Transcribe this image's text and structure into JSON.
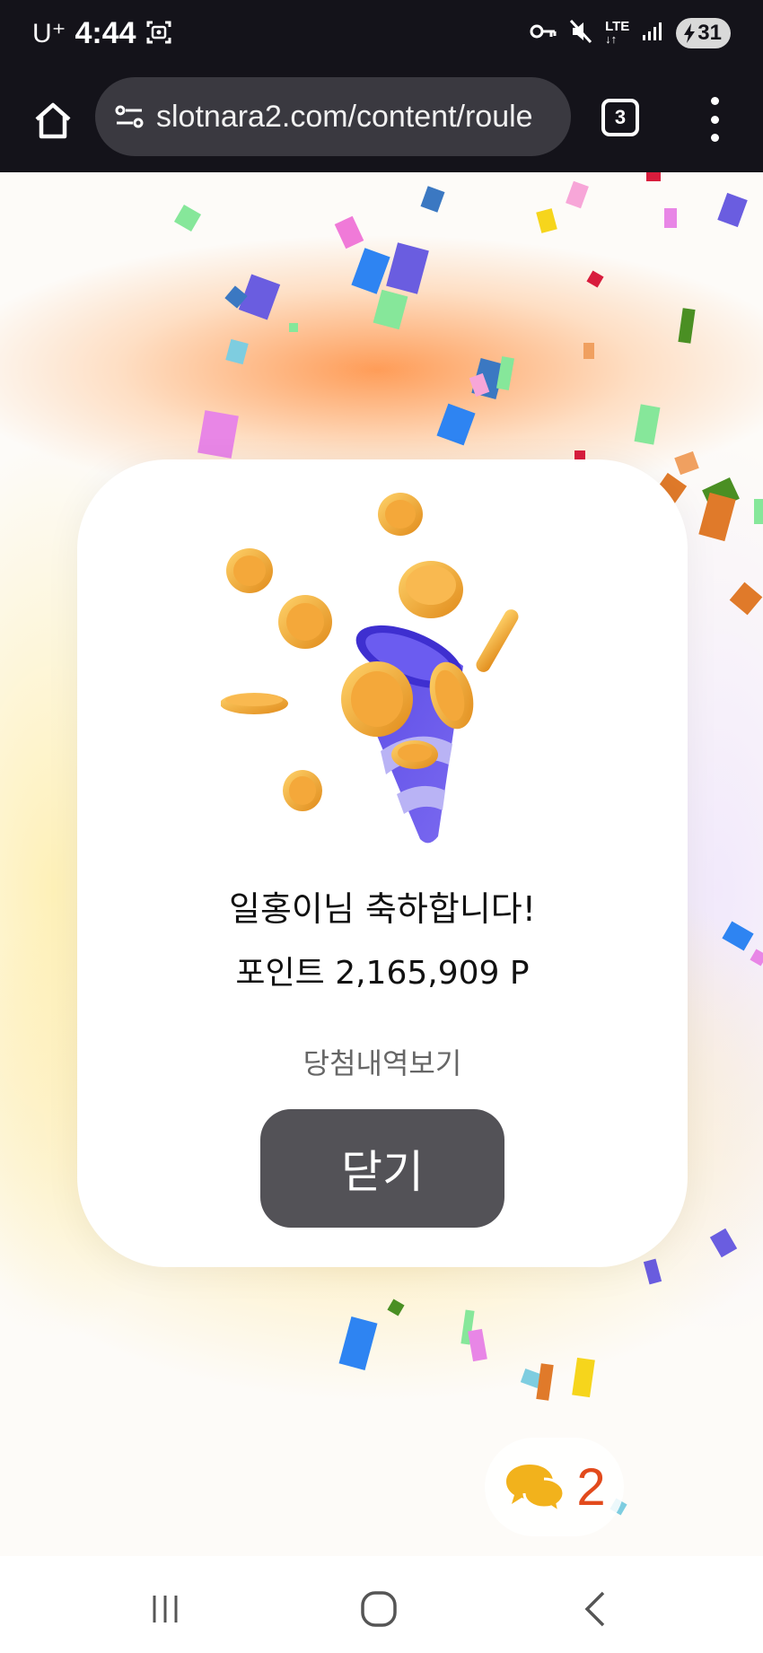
{
  "status_bar": {
    "carrier": "U⁺",
    "time": "4:44",
    "network": "LTE",
    "battery": "31"
  },
  "browser": {
    "url": "slotnara2.com/content/roule",
    "tab_count": "3"
  },
  "modal": {
    "congrats_text": "일홍이님 축하합니다!",
    "points_text": "포인트 2,165,909 P",
    "history_link": "당첨내역보기",
    "close_button": "닫기"
  },
  "chat_widget": {
    "count": "2",
    "icon_color": "#f2b21c",
    "count_color": "#e24a1c"
  },
  "colors": {
    "top_bar": "#14131a",
    "close_button_bg": "#535257"
  }
}
